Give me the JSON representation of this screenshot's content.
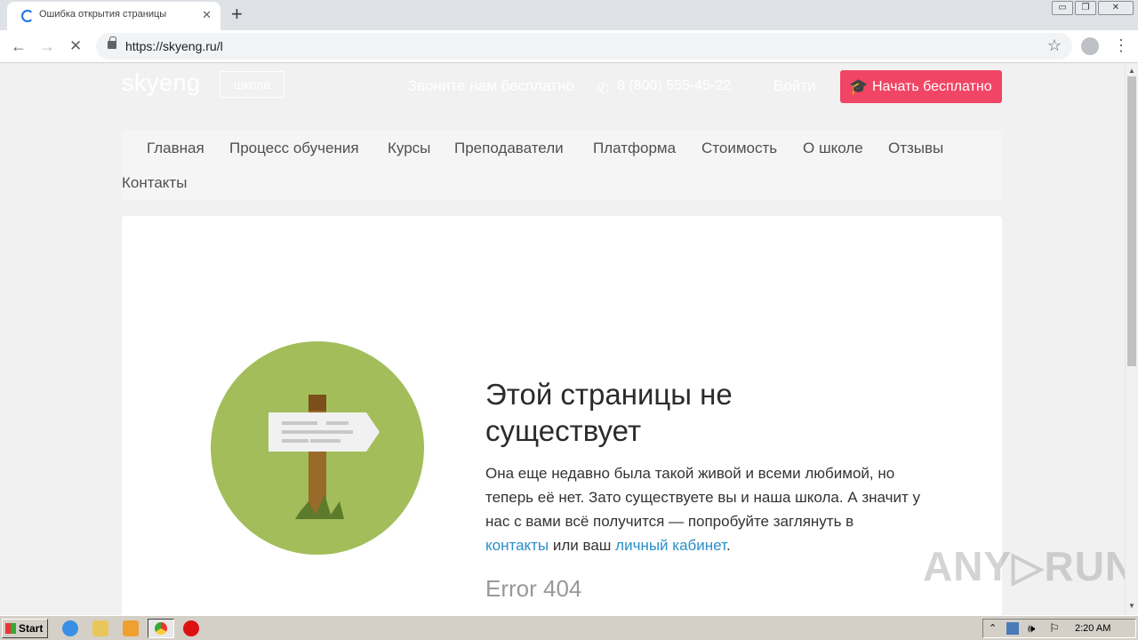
{
  "browser": {
    "tab_title": "Ошибка открытия страницы",
    "tab_close": "✕",
    "new_tab": "+",
    "url": "https://skyeng.ru/l",
    "back": "←",
    "forward": "→",
    "stop": "✕",
    "bookmark_star": "☆",
    "menu": "⋮",
    "win_minimize": "▭",
    "win_restore": "❐",
    "win_close": "✕"
  },
  "header": {
    "logo": "skyeng",
    "school_badge": "школа",
    "call_text": "Звоните нам бесплатно",
    "phone": "8 (800) 555-45-22",
    "login": "Войти",
    "start_button": "Начать бесплатно"
  },
  "nav": {
    "items": [
      "Главная",
      "Процесс обучения",
      "Курсы",
      "Преподаватели",
      "Платформа",
      "Стоимость",
      "О школе",
      "Отзывы",
      "Контакты"
    ]
  },
  "error": {
    "heading": "Этой страницы не существует",
    "text_1": "Она еще недавно была такой живой и всеми любимой, но теперь её нет. Зато существуете вы и наша школа. А значит у нас с вами всё получится — попробуйте заглянуть в ",
    "link_contacts": "контакты",
    "text_2": " или ваш ",
    "link_cabinet": "личный кабинет",
    "text_3": ".",
    "code": "Error 404"
  },
  "watermark": "ANY▷RUN",
  "taskbar": {
    "start": "Start",
    "clock": "2:20 AM"
  },
  "colors": {
    "accent": "#f04564",
    "link": "#2a8ec8",
    "circle": "#a3bd5a",
    "post": "#9a6a2a"
  }
}
